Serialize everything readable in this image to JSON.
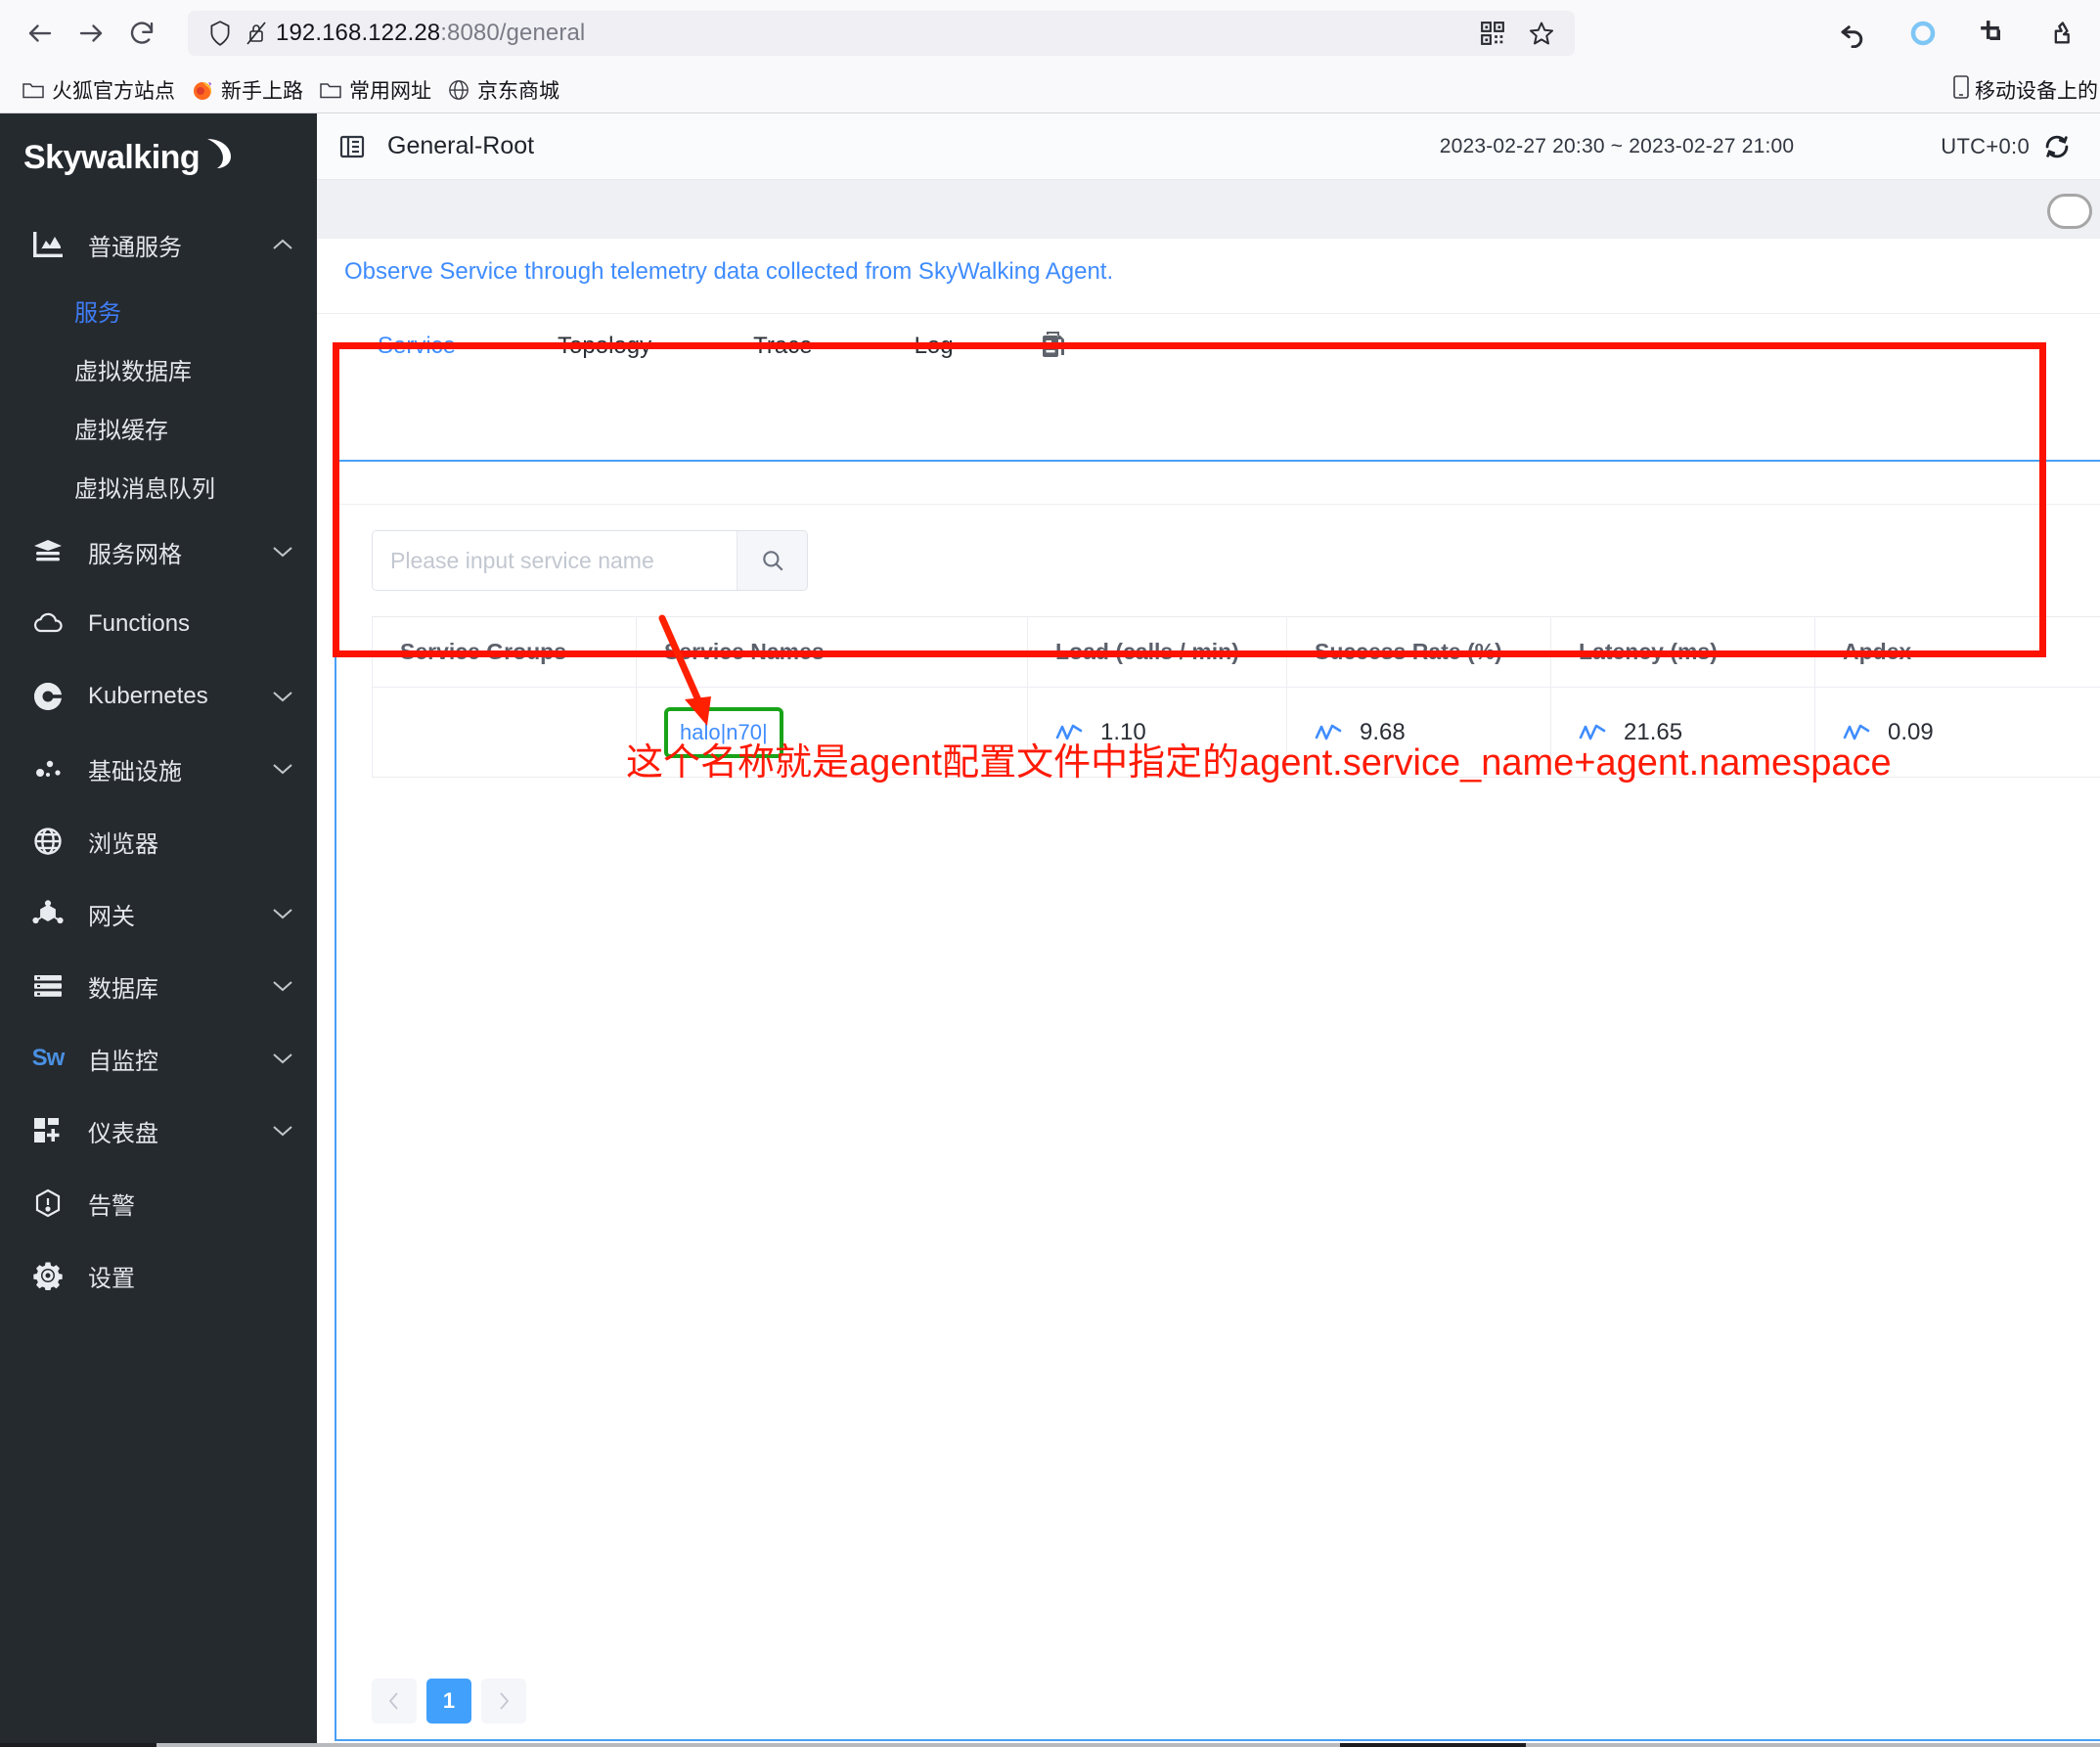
{
  "browser": {
    "back_icon": "back-arrow-icon",
    "forward_icon": "forward-arrow-icon",
    "reload_icon": "reload-icon",
    "shield_icon": "shield-icon",
    "lock_broken_icon": "lock-broken-icon",
    "url_host": "192.168.122.28",
    "url_rest": ":8080/general",
    "qr_icon": "qr-code-icon",
    "bookmark_star_icon": "star-icon",
    "toolbar_icons": [
      "undo-arrow-icon",
      "circle-sync-icon",
      "crop-icon",
      "clip-hand-icon"
    ],
    "bookmarks": [
      {
        "label": "火狐官方站点",
        "icon": "folder-icon"
      },
      {
        "label": "新手上路",
        "icon": "firefox-icon"
      },
      {
        "label": "常用网址",
        "icon": "folder-icon"
      },
      {
        "label": "京东商城",
        "icon": "globe-icon"
      }
    ],
    "bookmark_right": {
      "label": "移动设备上的",
      "icon": "mobile-icon"
    }
  },
  "sidebar": {
    "logo": "Skywalking",
    "items": [
      {
        "label": "普通服务",
        "icon": "chart-bar-icon",
        "chevron": "up",
        "expanded": true
      },
      {
        "label": "服务网格",
        "icon": "layers-icon",
        "chevron": "down"
      },
      {
        "label": "Functions",
        "icon": "cloud-icon",
        "chevron": ""
      },
      {
        "label": "Kubernetes",
        "icon": "kubernetes-icon",
        "chevron": "down"
      },
      {
        "label": "基础设施",
        "icon": "nodes-icon",
        "chevron": "down"
      },
      {
        "label": "浏览器",
        "icon": "globe-icon",
        "chevron": ""
      },
      {
        "label": "网关",
        "icon": "gateway-icon",
        "chevron": "down"
      },
      {
        "label": "数据库",
        "icon": "database-list-icon",
        "chevron": "down"
      },
      {
        "label": "自监控",
        "icon": "skywalking-mini-icon",
        "chevron": "down"
      },
      {
        "label": "仪表盘",
        "icon": "dashboard-icon",
        "chevron": "down"
      },
      {
        "label": "告警",
        "icon": "alert-icon",
        "chevron": ""
      },
      {
        "label": "设置",
        "icon": "gear-icon",
        "chevron": ""
      }
    ],
    "sub_items": [
      {
        "label": "服务",
        "active": true
      },
      {
        "label": "虚拟数据库",
        "active": false
      },
      {
        "label": "虚拟缓存",
        "active": false
      },
      {
        "label": "虚拟消息队列",
        "active": false
      }
    ]
  },
  "header": {
    "collapse_icon": "collapse-sidebar-icon",
    "title": "General-Root",
    "time_range": "2023-02-27 20:30 ~ 2023-02-27 21:00",
    "timezone": "UTC+0:0",
    "reload_icon": "refresh-icon"
  },
  "content": {
    "observe_text": "Observe Service through telemetry data collected from SkyWalking Agent.",
    "tabs": [
      {
        "label": "Service",
        "active": true
      },
      {
        "label": "Topology",
        "active": false
      },
      {
        "label": "Trace",
        "active": false
      },
      {
        "label": "Log",
        "active": false
      }
    ],
    "tab_extra_icon": "copy-icon"
  },
  "search": {
    "placeholder": "Please input service name",
    "value": "",
    "button_icon": "search-icon"
  },
  "table": {
    "columns": [
      "Service Groups",
      "Service Names",
      "Load (calls / min)",
      "Success Rate (%)",
      "Latency (ms)",
      "Apdex"
    ],
    "rows": [
      {
        "service_group": "",
        "service_name": "halo|n70|",
        "load": "1.10",
        "success_rate": "9.68",
        "latency": "21.65",
        "apdex": "0.09"
      }
    ],
    "sparkline_icon": "sparkline-icon"
  },
  "pagination": {
    "prev_icon": "chevron-left-icon",
    "next_icon": "chevron-right-icon",
    "pages": [
      "1"
    ],
    "current": "1"
  },
  "annotations": {
    "red_box": "#fd1200",
    "green_box": "#19a319",
    "arrow_color": "#ff2000",
    "note_text": "这个名称就是agent配置文件中指定的agent.service_name+agent.namespace",
    "note_color": "#ff1a05"
  }
}
